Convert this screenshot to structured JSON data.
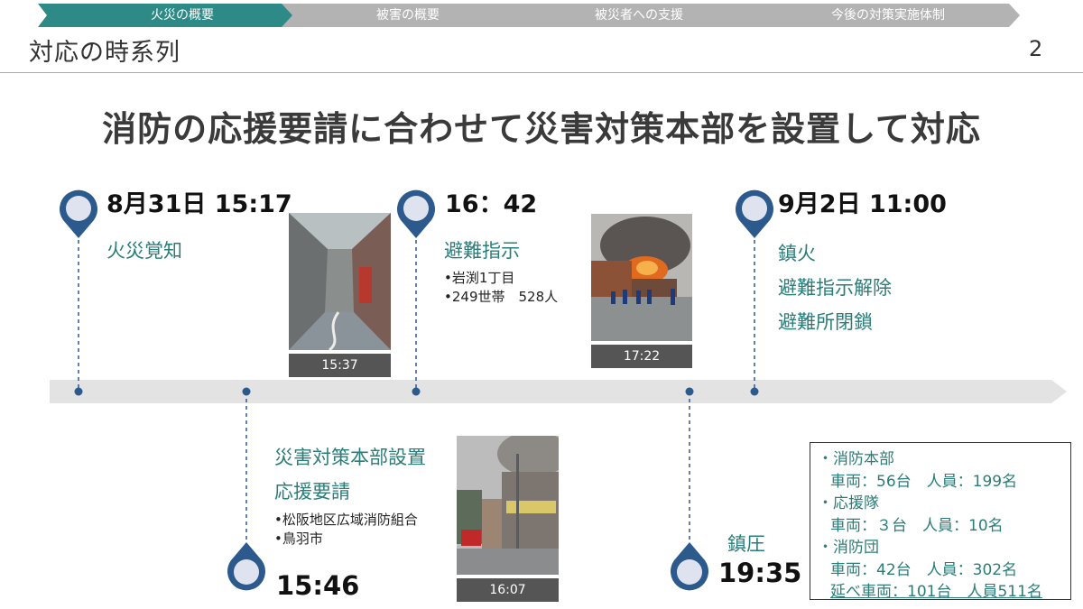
{
  "nav": {
    "steps": [
      {
        "label": "火災の概要",
        "active": true
      },
      {
        "label": "被害の概要",
        "active": false
      },
      {
        "label": "被災者への支援",
        "active": false
      },
      {
        "label": "今後の対策実施体制",
        "active": false
      }
    ],
    "active_color": "#2e8a86",
    "inactive_color": "#b3b3b3"
  },
  "header": {
    "title": "対応の時系列",
    "page_number": "2"
  },
  "headline": "消防の応援要請に合わせて災害対策本部を設置して対応",
  "events": {
    "e1": {
      "time": "8月31日 15:17",
      "label": "火災覚知"
    },
    "e2": {
      "time": "16：42",
      "label": "避難指示",
      "bullets": [
        "岩渕1丁目",
        "249世帯　528人"
      ]
    },
    "e3": {
      "time": "9月2日 11:00",
      "lines": [
        "鎮火",
        "避難指示解除",
        "避難所閉鎖"
      ]
    },
    "e4": {
      "time": "15:46",
      "lines": [
        "災害対策本部設置",
        "応援要請"
      ],
      "bullets": [
        "松阪地区広域消防組合",
        "鳥羽市"
      ]
    },
    "e5": {
      "time": "19:35",
      "label": "鎮圧"
    }
  },
  "photos": {
    "p1": {
      "caption": "15:37"
    },
    "p2": {
      "caption": "17:22"
    },
    "p3": {
      "caption": "16:07"
    }
  },
  "resources": {
    "items": [
      {
        "org": "・消防本部",
        "detail": "車両：56台　人員：199名"
      },
      {
        "org": "・応援隊",
        "detail": "車両：３台　人員：10名"
      },
      {
        "org": "・消防団",
        "detail": "車両：42台　人員：302名"
      }
    ],
    "total": "延べ車両：101台　人員511名"
  },
  "colors": {
    "accent": "#2a7d79",
    "pin": "#2d5a8c",
    "pin_fill": "#dfe3ef"
  }
}
